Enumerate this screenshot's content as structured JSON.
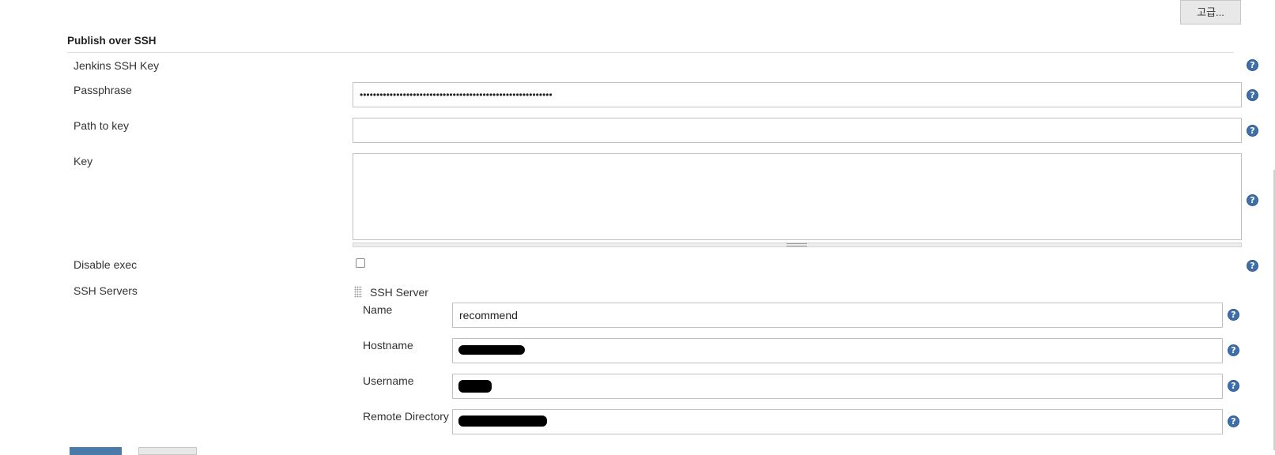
{
  "advanced_button": {
    "label": "고급..."
  },
  "section": {
    "title": "Publish over SSH"
  },
  "fields": {
    "jenkins_ssh_key": {
      "label": "Jenkins SSH Key"
    },
    "passphrase": {
      "label": "Passphrase",
      "value": "••••••••••••••••••••••••••••••••••••••••••••••••••••••••••"
    },
    "path_to_key": {
      "label": "Path to key",
      "value": ""
    },
    "key": {
      "label": "Key",
      "value": ""
    },
    "disable_exec": {
      "label": "Disable exec",
      "checked": false
    },
    "ssh_servers": {
      "label": "SSH Servers"
    }
  },
  "ssh_server": {
    "title": "SSH Server",
    "name": {
      "label": "Name",
      "value": "recommend"
    },
    "hostname": {
      "label": "Hostname",
      "value": ""
    },
    "username": {
      "label": "Username",
      "value": ""
    },
    "remote_directory": {
      "label": "Remote Directory",
      "value": ""
    }
  },
  "icons": {
    "help": "?"
  },
  "colors": {
    "help_icon": "#3f6fa8",
    "primary_button": "#4a7aa8",
    "advanced_button_bg": "#e8e8e8"
  }
}
